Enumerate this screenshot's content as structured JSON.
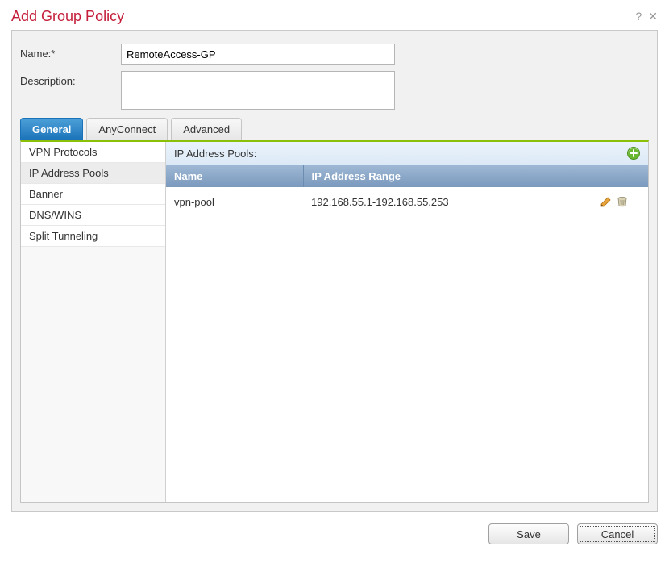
{
  "dialog": {
    "title": "Add Group Policy"
  },
  "form": {
    "name_label": "Name:*",
    "name_value": "RemoteAccess-GP",
    "description_label": "Description:",
    "description_value": ""
  },
  "tabs": {
    "general": "General",
    "anyconnect": "AnyConnect",
    "advanced": "Advanced",
    "active": "general"
  },
  "sidebar": {
    "items": [
      {
        "id": "vpn-protocols",
        "label": "VPN Protocols"
      },
      {
        "id": "ip-address-pools",
        "label": "IP Address Pools"
      },
      {
        "id": "banner",
        "label": "Banner"
      },
      {
        "id": "dns-wins",
        "label": "DNS/WINS"
      },
      {
        "id": "split-tunneling",
        "label": "Split Tunneling"
      }
    ],
    "selected": "ip-address-pools"
  },
  "pane": {
    "title": "IP Address Pools:",
    "columns": {
      "name": "Name",
      "range": "IP Address Range"
    },
    "rows": [
      {
        "name": "vpn-pool",
        "range": "192.168.55.1-192.168.55.253"
      }
    ]
  },
  "footer": {
    "save": "Save",
    "cancel": "Cancel"
  }
}
